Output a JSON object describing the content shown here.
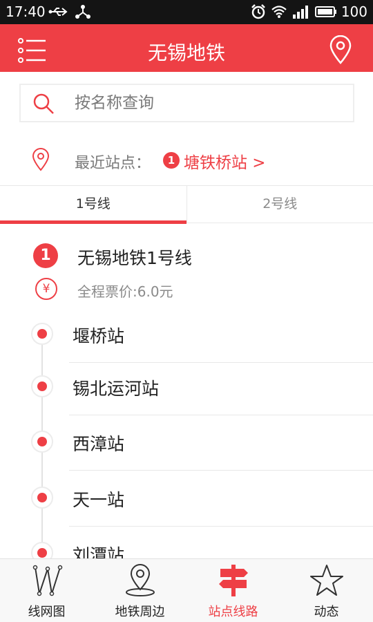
{
  "status_bar": {
    "time": "17:40",
    "battery": "100"
  },
  "header": {
    "title": "无锡地铁"
  },
  "search": {
    "placeholder": "按名称查询"
  },
  "nearest": {
    "label": "最近站点：",
    "line_badge": "1",
    "station": "塘铁桥站 >"
  },
  "tabs": [
    {
      "label": "1号线",
      "active": true
    },
    {
      "label": "2号线",
      "active": false
    }
  ],
  "line": {
    "number": "1",
    "name": "无锡地铁1号线",
    "fare_icon": "¥",
    "fare": "全程票价:6.0元"
  },
  "stations": [
    "堰桥站",
    "锡北运河站",
    "西漳站",
    "天一站",
    "刘潭站"
  ],
  "bottom_nav": [
    {
      "label": "线网图",
      "icon": "network-map-icon"
    },
    {
      "label": "地铁周边",
      "icon": "location-pin-icon"
    },
    {
      "label": "站点线路",
      "icon": "signpost-icon",
      "active": true
    },
    {
      "label": "动态",
      "icon": "star-icon"
    }
  ],
  "colors": {
    "accent": "#ee3f45",
    "status_bar": "#141414"
  }
}
